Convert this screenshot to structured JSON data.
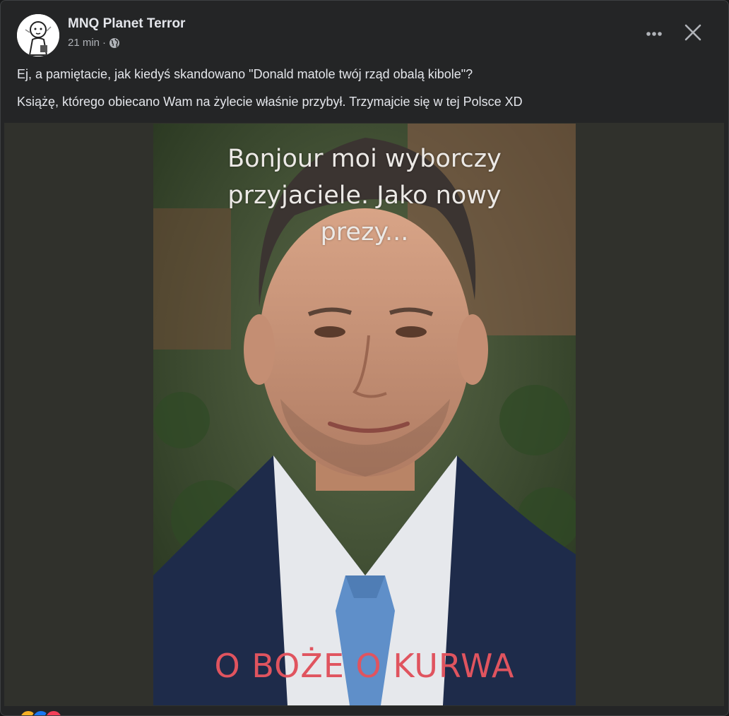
{
  "post": {
    "author": "MNQ Planet Terror",
    "time": "21 min",
    "separator": "·",
    "privacy_icon": "globe-icon",
    "text_lines": [
      "Ej, a pamiętacie, jak kiedyś skandowano \"Donald matole twój rząd obalą kibole\"?",
      "Książę, którego obiecano Wam na żylecie właśnie przybył. Trzymajcie się w tej Polsce XD"
    ]
  },
  "actions": {
    "more_icon": "more-horizontal-icon",
    "close_icon": "close-icon"
  },
  "meme": {
    "top_text": "Bonjour moi wyborczy\nprzyjaciele. Jako nowy\nprezy...",
    "bottom_text": "O BOŻE O KURWA"
  },
  "reactions": [
    "haha-reaction",
    "like-reaction",
    "love-reaction"
  ],
  "colors": {
    "card_bg": "#242526",
    "text_primary": "#e4e6eb",
    "text_secondary": "#b0b3b8",
    "meme_red": "#e0545f"
  }
}
